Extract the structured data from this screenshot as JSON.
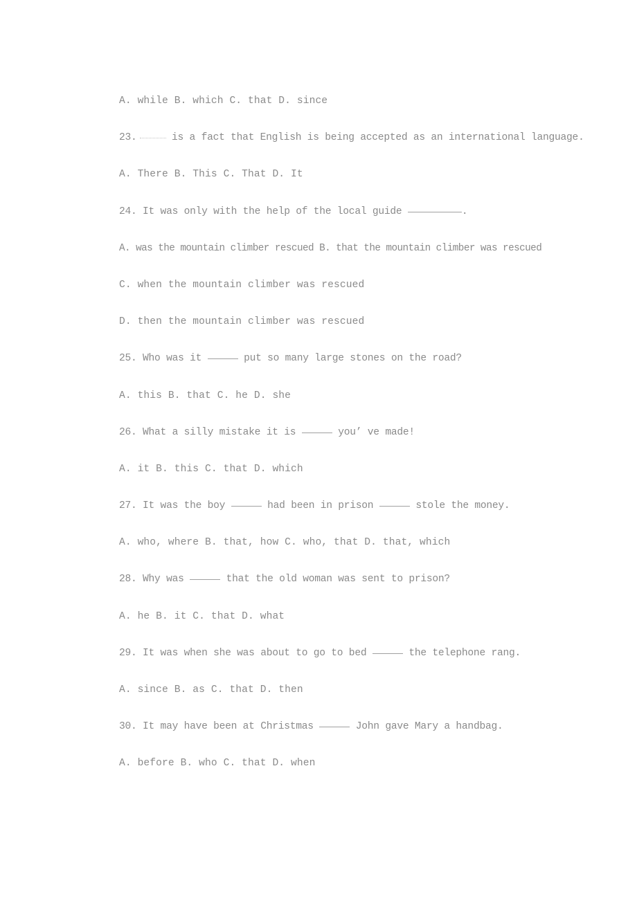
{
  "document": {
    "text_color": "#8a8a8a",
    "background_color": "#ffffff",
    "blank_color": "#a0a0a0",
    "lines": [
      {
        "id": "l01",
        "kind": "options",
        "text": "A. while B. which C. that D. since"
      },
      {
        "id": "l02",
        "kind": "question",
        "number": "23.",
        "before": "",
        "after": " is a fact that English is being accepted as an international language.",
        "blank": "dotted-short"
      },
      {
        "id": "l03",
        "kind": "options",
        "text": "A. There B. This C. That D. It"
      },
      {
        "id": "l04",
        "kind": "question",
        "number": "24.",
        "before": " It was only with the help of the local guide ",
        "after": ".",
        "blank": "solid-long"
      },
      {
        "id": "l05",
        "kind": "options",
        "text": "A. was the mountain climber rescued B. that the mountain climber was rescued"
      },
      {
        "id": "l06",
        "kind": "options",
        "text": "C. when the mountain climber was rescued"
      },
      {
        "id": "l07",
        "kind": "options",
        "text": "D. then the mountain climber was rescued"
      },
      {
        "id": "l08",
        "kind": "question",
        "number": "25.",
        "before": " Who was it ",
        "after": " put so many large stones on the road?",
        "blank": "solid-med"
      },
      {
        "id": "l09",
        "kind": "options",
        "text": "A. this B. that C. he D. she"
      },
      {
        "id": "l10",
        "kind": "question",
        "number": "26.",
        "before": " What a silly mistake it is ",
        "after": " you’ ve made!",
        "blank": "solid-med"
      },
      {
        "id": "l11",
        "kind": "options",
        "text": "A. it B. this C. that D. which"
      },
      {
        "id": "l12",
        "kind": "question",
        "number": "27.",
        "before": " It was the boy ",
        "middle": " had been in prison ",
        "after": " stole the money.",
        "blank": "solid-med"
      },
      {
        "id": "l13",
        "kind": "options",
        "text": "A. who, where B. that, how C. who, that D. that, which"
      },
      {
        "id": "l14",
        "kind": "question",
        "number": "28.",
        "before": " Why was ",
        "after": " that the old woman was sent to prison?",
        "blank": "solid-med"
      },
      {
        "id": "l15",
        "kind": "options",
        "text": "A. he B. it C. that D. what"
      },
      {
        "id": "l16",
        "kind": "question",
        "number": "29.",
        "before": " It was when she was about to go to bed ",
        "after": " the telephone rang.",
        "blank": "solid-med"
      },
      {
        "id": "l17",
        "kind": "options",
        "text": "A. since B. as C. that D. then"
      },
      {
        "id": "l18",
        "kind": "question",
        "number": "30.",
        "before": " It may have been at Christmas ",
        "after": " John gave Mary a handbag.",
        "blank": "solid-med"
      },
      {
        "id": "l19",
        "kind": "options",
        "text": "A. before B. who C. that D. when"
      }
    ]
  }
}
